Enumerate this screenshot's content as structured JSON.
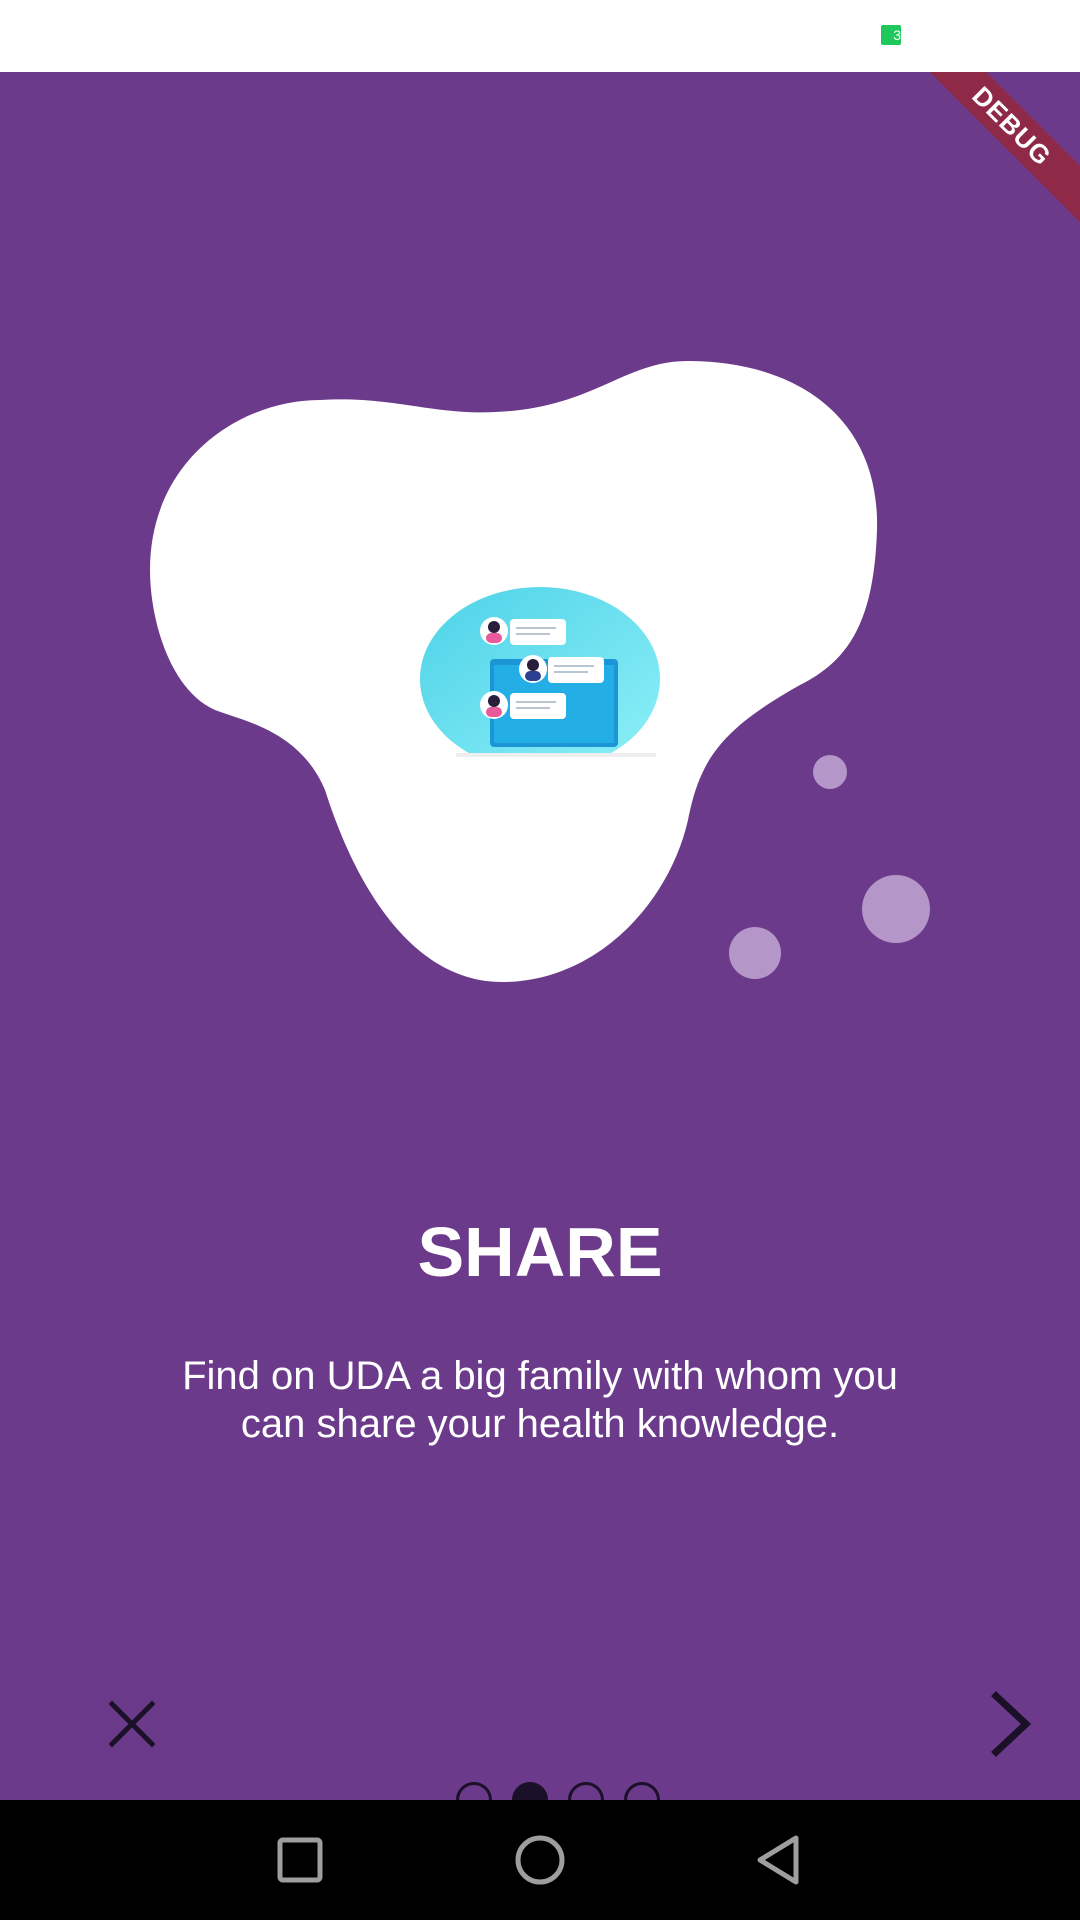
{
  "status_bar": {
    "battery_label": "3"
  },
  "debug_banner": {
    "label": "DEBUG"
  },
  "onboarding": {
    "title": "SHARE",
    "description": "Find on UDA a big family with whom you can share your health knowledge.",
    "current_page": 2,
    "total_pages": 4
  },
  "controls": {
    "close_icon": "close-icon",
    "next_icon": "chevron-right-icon",
    "page_dots": [
      {
        "active": false
      },
      {
        "active": true
      },
      {
        "active": false
      },
      {
        "active": false
      }
    ]
  },
  "system_nav": {
    "icons": [
      "recent-apps-icon",
      "home-icon",
      "back-icon"
    ]
  },
  "colors": {
    "background": "#6b3a8a",
    "blob": "#ffffff",
    "bubbles": "#b497c8",
    "controls": "#1a1028",
    "debug_ribbon": "#8e2a47",
    "battery": "#1ec85a"
  }
}
